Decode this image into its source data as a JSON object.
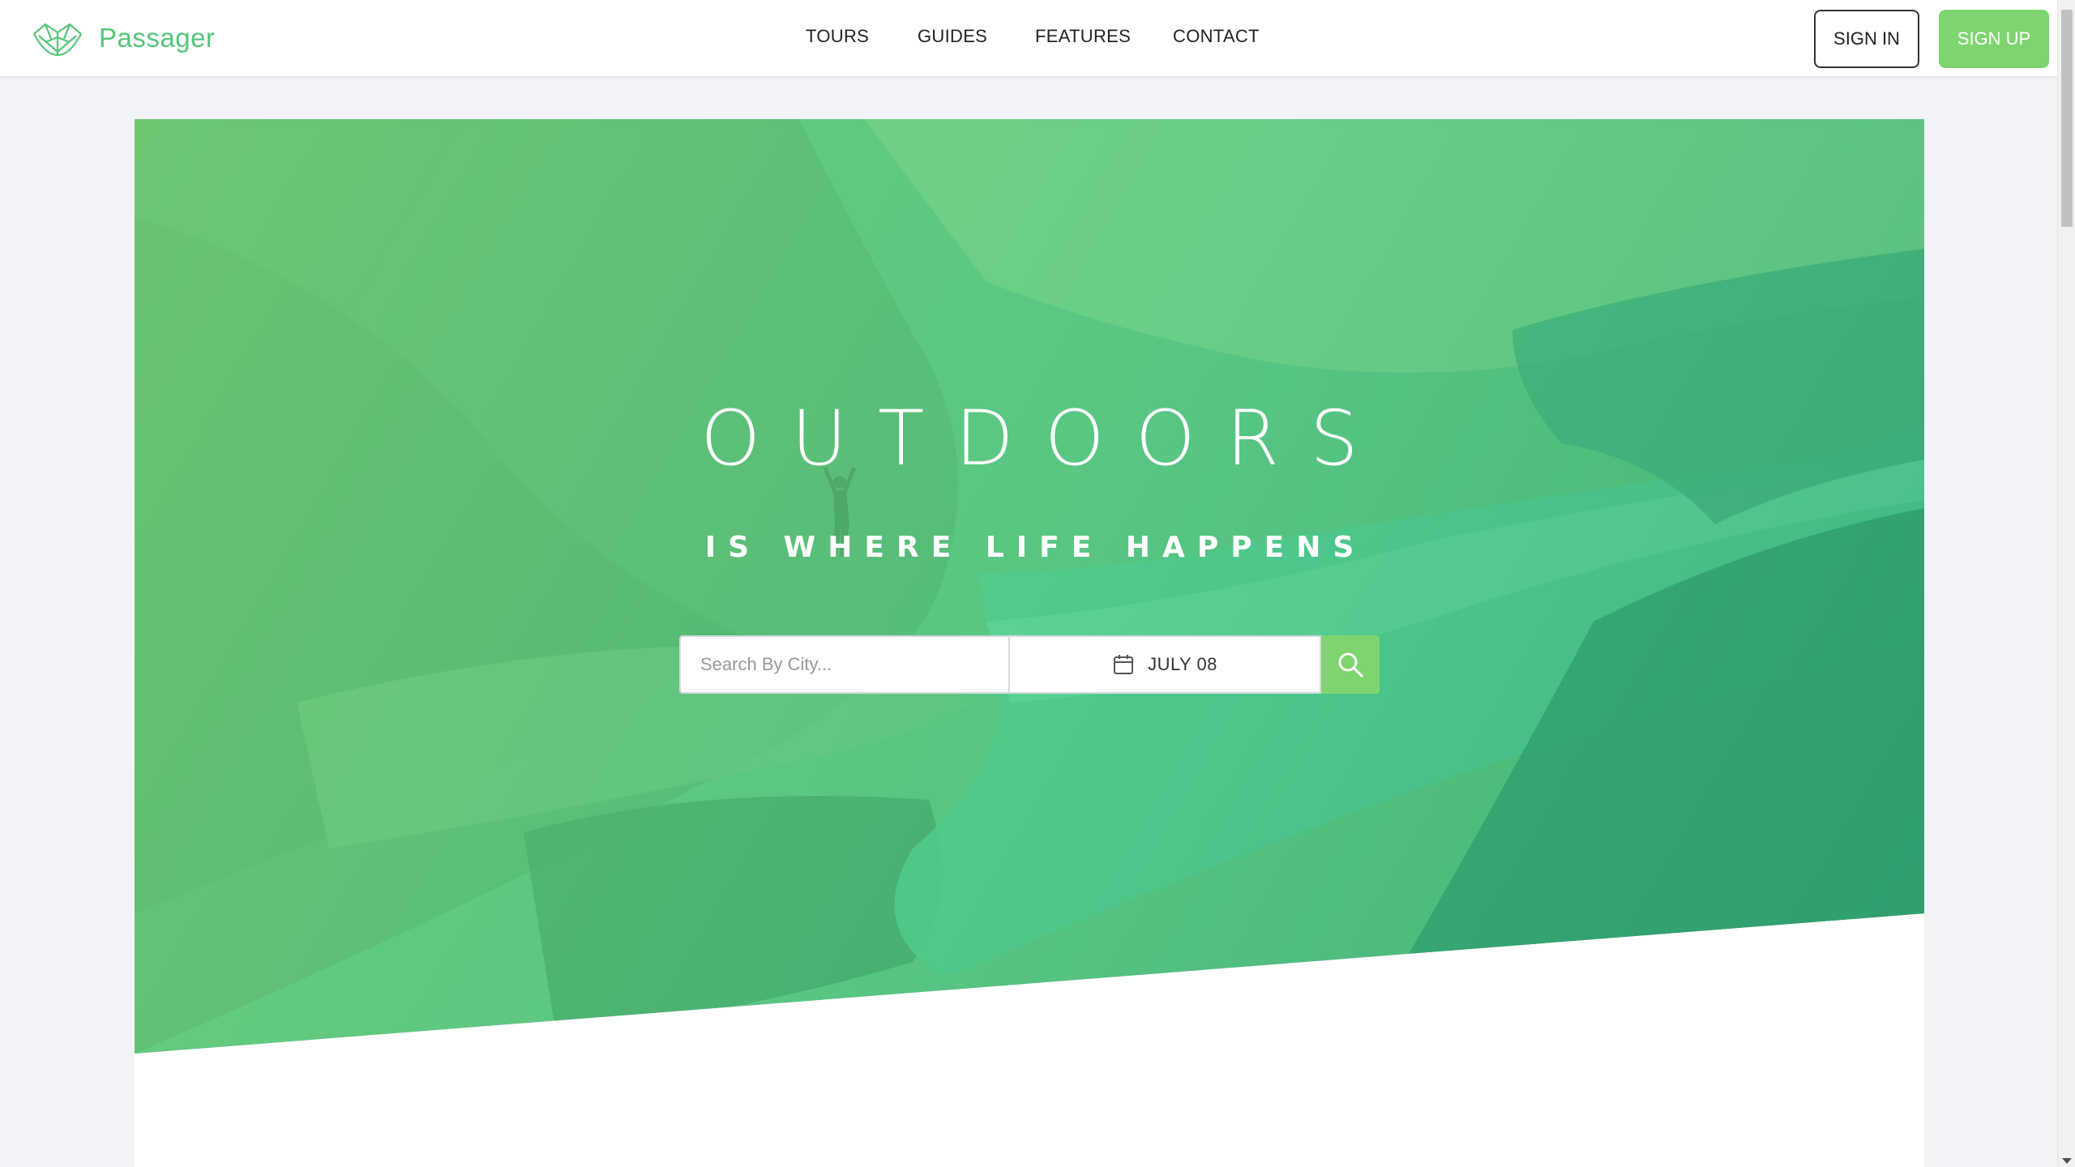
{
  "brand": {
    "name": "Passager",
    "logo_icon": "leaf-mountain-logo-icon"
  },
  "nav": {
    "items": [
      {
        "label": "TOURS"
      },
      {
        "label": "GUIDES"
      },
      {
        "label": "FEATURES"
      },
      {
        "label": "CONTACT"
      }
    ]
  },
  "auth": {
    "signin_label": "SIGN IN",
    "signup_label": "SIGN UP"
  },
  "hero": {
    "title": "OUTDOORS",
    "subtitle": "IS WHERE LIFE HAPPENS"
  },
  "search": {
    "placeholder": "Search By City...",
    "date_value": "JULY 08",
    "date_icon": "calendar-icon",
    "button_icon": "search-icon"
  },
  "colors": {
    "accent": "#55c57a",
    "button_green": "#7ed56f",
    "hero_dark": "#28b485"
  }
}
